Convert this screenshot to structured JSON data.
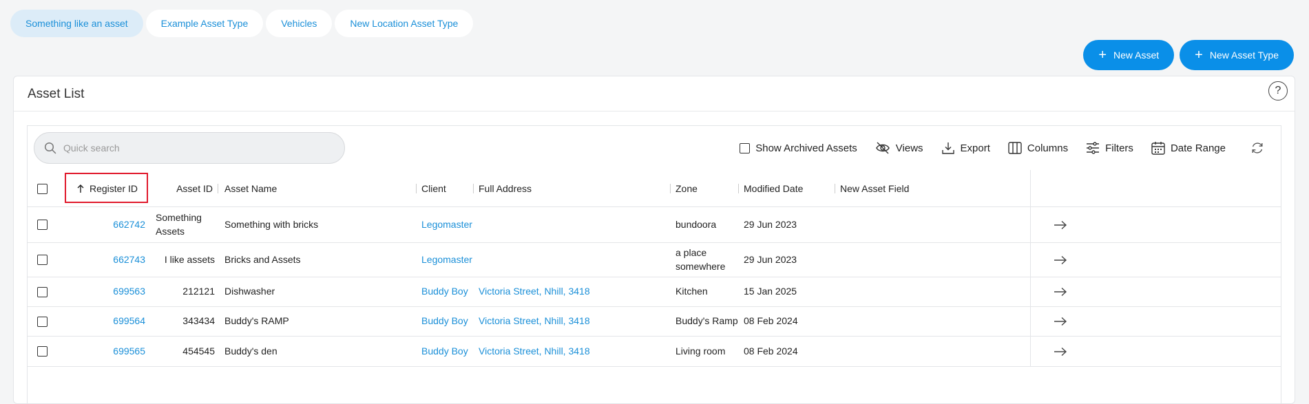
{
  "tabs": [
    {
      "label": "Something like an asset",
      "active": true
    },
    {
      "label": "Example Asset Type",
      "active": false
    },
    {
      "label": "Vehicles",
      "active": false
    },
    {
      "label": "New Location Asset Type",
      "active": false
    }
  ],
  "actions": {
    "new_asset": "New Asset",
    "new_asset_type": "New Asset Type",
    "plus_glyph": "+"
  },
  "card": {
    "title": "Asset List",
    "help_glyph": "?"
  },
  "toolbar": {
    "search_placeholder": "Quick search",
    "show_archived": "Show Archived Assets",
    "views": "Views",
    "export": "Export",
    "columns": "Columns",
    "filters": "Filters",
    "date_range": "Date Range"
  },
  "table": {
    "sort_icon": "arrow-up-icon",
    "columns": {
      "register_id": "Register ID",
      "asset_id": "Asset ID",
      "asset_name": "Asset Name",
      "client": "Client",
      "full_address": "Full Address",
      "zone": "Zone",
      "modified_date": "Modified Date",
      "new_asset_field": "New Asset Field"
    },
    "rows": [
      {
        "register_id": "662742",
        "asset_id": "Something Assets",
        "asset_name": "Something with bricks",
        "client": "Legomaster",
        "full_address": "",
        "zone": "bundoora",
        "modified_date": "29 Jun 2023",
        "new_asset_field": ""
      },
      {
        "register_id": "662743",
        "asset_id": "I like assets",
        "asset_name": "Bricks and Assets",
        "client": "Legomaster",
        "full_address": "",
        "zone": "a place somewhere",
        "modified_date": "29 Jun 2023",
        "new_asset_field": ""
      },
      {
        "register_id": "699563",
        "asset_id": "212121",
        "asset_name": "Dishwasher",
        "client": "Buddy Boy",
        "full_address": "Victoria Street, Nhill, 3418",
        "zone": "Kitchen",
        "modified_date": "15 Jan 2025",
        "new_asset_field": ""
      },
      {
        "register_id": "699564",
        "asset_id": "343434",
        "asset_name": "Buddy's RAMP",
        "client": "Buddy Boy",
        "full_address": "Victoria Street, Nhill, 3418",
        "zone": "Buddy's Ramp",
        "modified_date": "08 Feb 2024",
        "new_asset_field": ""
      },
      {
        "register_id": "699565",
        "asset_id": "454545",
        "asset_name": "Buddy's den",
        "client": "Buddy Boy",
        "full_address": "Victoria Street, Nhill, 3418",
        "zone": "Living room",
        "modified_date": "08 Feb 2024",
        "new_asset_field": ""
      }
    ]
  },
  "colors": {
    "accent": "#0a8fe8",
    "link": "#1a8fd8",
    "active_tab_bg": "#dcecf8",
    "highlight_border": "#e0182b"
  }
}
